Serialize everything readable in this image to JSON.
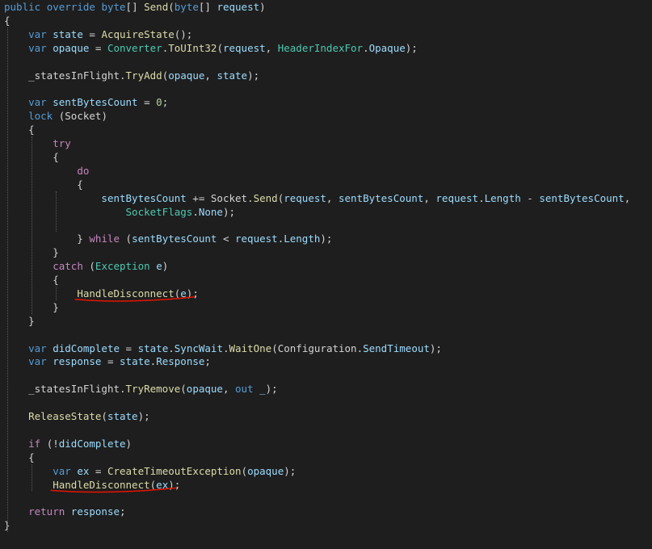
{
  "colors": {
    "background": "#1e1e1e",
    "keyword": "#569cd6",
    "control": "#c586c0",
    "type": "#4ec9b0",
    "method": "#dcdcaa",
    "variable": "#9cdcfe",
    "field": "#d4d4d4",
    "number": "#b5cea8",
    "text": "#d4d4d4",
    "indent_guide": "#5a5a5a",
    "squiggle": "#e51400"
  },
  "code": {
    "lines": [
      [
        [
          "k",
          "public"
        ],
        [
          "p",
          " "
        ],
        [
          "k",
          "override"
        ],
        [
          "p",
          " "
        ],
        [
          "k",
          "byte"
        ],
        [
          "p",
          "[] "
        ],
        [
          "m",
          "Send"
        ],
        [
          "p",
          "("
        ],
        [
          "k",
          "byte"
        ],
        [
          "p",
          "[] "
        ],
        [
          "v",
          "request"
        ],
        [
          "p",
          ")"
        ]
      ],
      [
        [
          "p",
          "{"
        ]
      ],
      [
        [
          "p",
          "    "
        ],
        [
          "k",
          "var"
        ],
        [
          "p",
          " "
        ],
        [
          "v",
          "state"
        ],
        [
          "p",
          " = "
        ],
        [
          "m",
          "AcquireState"
        ],
        [
          "p",
          "();"
        ]
      ],
      [
        [
          "p",
          "    "
        ],
        [
          "k",
          "var"
        ],
        [
          "p",
          " "
        ],
        [
          "v",
          "opaque"
        ],
        [
          "p",
          " = "
        ],
        [
          "t",
          "Converter"
        ],
        [
          "p",
          "."
        ],
        [
          "m",
          "ToUInt32"
        ],
        [
          "p",
          "("
        ],
        [
          "v",
          "request"
        ],
        [
          "p",
          ", "
        ],
        [
          "t",
          "HeaderIndexFor"
        ],
        [
          "p",
          "."
        ],
        [
          "v",
          "Opaque"
        ],
        [
          "p",
          ");"
        ]
      ],
      [],
      [
        [
          "p",
          "    "
        ],
        [
          "f",
          "_statesInFlight"
        ],
        [
          "p",
          "."
        ],
        [
          "m",
          "TryAdd"
        ],
        [
          "p",
          "("
        ],
        [
          "v",
          "opaque"
        ],
        [
          "p",
          ", "
        ],
        [
          "v",
          "state"
        ],
        [
          "p",
          ");"
        ]
      ],
      [],
      [
        [
          "p",
          "    "
        ],
        [
          "k",
          "var"
        ],
        [
          "p",
          " "
        ],
        [
          "v",
          "sentBytesCount"
        ],
        [
          "p",
          " = "
        ],
        [
          "n",
          "0"
        ],
        [
          "p",
          ";"
        ]
      ],
      [
        [
          "p",
          "    "
        ],
        [
          "k",
          "lock"
        ],
        [
          "p",
          " ("
        ],
        [
          "f",
          "Socket"
        ],
        [
          "p",
          ")"
        ]
      ],
      [
        [
          "p",
          "    {"
        ]
      ],
      [
        [
          "p",
          "        "
        ],
        [
          "c",
          "try"
        ]
      ],
      [
        [
          "p",
          "        {"
        ]
      ],
      [
        [
          "p",
          "            "
        ],
        [
          "c",
          "do"
        ]
      ],
      [
        [
          "p",
          "            {"
        ]
      ],
      [
        [
          "p",
          "                "
        ],
        [
          "v",
          "sentBytesCount"
        ],
        [
          "p",
          " += "
        ],
        [
          "f",
          "Socket"
        ],
        [
          "p",
          "."
        ],
        [
          "m",
          "Send"
        ],
        [
          "p",
          "("
        ],
        [
          "v",
          "request"
        ],
        [
          "p",
          ", "
        ],
        [
          "v",
          "sentBytesCount"
        ],
        [
          "p",
          ", "
        ],
        [
          "v",
          "request"
        ],
        [
          "p",
          "."
        ],
        [
          "v",
          "Length"
        ],
        [
          "p",
          " - "
        ],
        [
          "v",
          "sentBytesCount"
        ],
        [
          "p",
          ","
        ]
      ],
      [
        [
          "p",
          "                    "
        ],
        [
          "t",
          "SocketFlags"
        ],
        [
          "p",
          "."
        ],
        [
          "v",
          "None"
        ],
        [
          "p",
          ");"
        ]
      ],
      [],
      [
        [
          "p",
          "            } "
        ],
        [
          "c",
          "while"
        ],
        [
          "p",
          " ("
        ],
        [
          "v",
          "sentBytesCount"
        ],
        [
          "p",
          " < "
        ],
        [
          "v",
          "request"
        ],
        [
          "p",
          "."
        ],
        [
          "v",
          "Length"
        ],
        [
          "p",
          ");"
        ]
      ],
      [
        [
          "p",
          "        }"
        ]
      ],
      [
        [
          "p",
          "        "
        ],
        [
          "c",
          "catch"
        ],
        [
          "p",
          " ("
        ],
        [
          "t",
          "Exception"
        ],
        [
          "p",
          " "
        ],
        [
          "v",
          "e"
        ],
        [
          "p",
          ")"
        ]
      ],
      [
        [
          "p",
          "        {"
        ]
      ],
      [
        [
          "p",
          "            "
        ],
        [
          "m",
          "HandleDisconnect"
        ],
        [
          "p",
          "("
        ],
        [
          "v",
          "e"
        ],
        [
          "p",
          ");"
        ]
      ],
      [
        [
          "p",
          "        }"
        ]
      ],
      [
        [
          "p",
          "    }"
        ]
      ],
      [],
      [
        [
          "p",
          "    "
        ],
        [
          "k",
          "var"
        ],
        [
          "p",
          " "
        ],
        [
          "v",
          "didComplete"
        ],
        [
          "p",
          " = "
        ],
        [
          "v",
          "state"
        ],
        [
          "p",
          "."
        ],
        [
          "v",
          "SyncWait"
        ],
        [
          "p",
          "."
        ],
        [
          "m",
          "WaitOne"
        ],
        [
          "p",
          "("
        ],
        [
          "f",
          "Configuration"
        ],
        [
          "p",
          "."
        ],
        [
          "v",
          "SendTimeout"
        ],
        [
          "p",
          ");"
        ]
      ],
      [
        [
          "p",
          "    "
        ],
        [
          "k",
          "var"
        ],
        [
          "p",
          " "
        ],
        [
          "v",
          "response"
        ],
        [
          "p",
          " = "
        ],
        [
          "v",
          "state"
        ],
        [
          "p",
          "."
        ],
        [
          "v",
          "Response"
        ],
        [
          "p",
          ";"
        ]
      ],
      [],
      [
        [
          "p",
          "    "
        ],
        [
          "f",
          "_statesInFlight"
        ],
        [
          "p",
          "."
        ],
        [
          "m",
          "TryRemove"
        ],
        [
          "p",
          "("
        ],
        [
          "v",
          "opaque"
        ],
        [
          "p",
          ", "
        ],
        [
          "k",
          "out"
        ],
        [
          "p",
          " "
        ],
        [
          "v",
          "_"
        ],
        [
          "p",
          ");"
        ]
      ],
      [],
      [
        [
          "p",
          "    "
        ],
        [
          "m",
          "ReleaseState"
        ],
        [
          "p",
          "("
        ],
        [
          "v",
          "state"
        ],
        [
          "p",
          ");"
        ]
      ],
      [],
      [
        [
          "p",
          "    "
        ],
        [
          "c",
          "if"
        ],
        [
          "p",
          " (!"
        ],
        [
          "v",
          "didComplete"
        ],
        [
          "p",
          ")"
        ]
      ],
      [
        [
          "p",
          "    {"
        ]
      ],
      [
        [
          "p",
          "        "
        ],
        [
          "k",
          "var"
        ],
        [
          "p",
          " "
        ],
        [
          "v",
          "ex"
        ],
        [
          "p",
          " = "
        ],
        [
          "m",
          "CreateTimeoutException"
        ],
        [
          "p",
          "("
        ],
        [
          "v",
          "opaque"
        ],
        [
          "p",
          ");"
        ]
      ],
      [
        [
          "p",
          "        "
        ],
        [
          "m",
          "HandleDisconnect"
        ],
        [
          "p",
          "("
        ],
        [
          "v",
          "ex"
        ],
        [
          "p",
          ");"
        ]
      ],
      [],
      [
        [
          "p",
          "    "
        ],
        [
          "c",
          "return"
        ],
        [
          "p",
          " "
        ],
        [
          "v",
          "response"
        ],
        [
          "p",
          ";"
        ]
      ],
      [
        [
          "p",
          "}"
        ]
      ]
    ],
    "squiggles": [
      {
        "line": 21,
        "from_col": 12,
        "to_col": 31
      },
      {
        "line": 35,
        "from_col": 8,
        "to_col": 28
      }
    ],
    "guides": [
      {
        "col": 0,
        "from_line": 2,
        "to_line": 38
      },
      {
        "col": 4,
        "from_line": 10,
        "to_line": 22
      },
      {
        "col": 8,
        "from_line": 14,
        "to_line": 16
      },
      {
        "col": 8,
        "from_line": 21,
        "to_line": 21
      },
      {
        "col": 4,
        "from_line": 34,
        "to_line": 35
      }
    ]
  }
}
